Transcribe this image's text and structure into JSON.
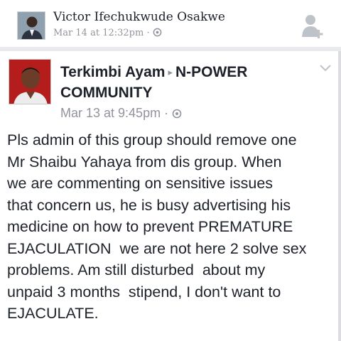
{
  "top_post": {
    "author": "Victor Ifechukwude Osakwe",
    "timestamp": "Mar 14 at 12:32pm",
    "separator": "·",
    "privacy_icon": "globe-icon",
    "action_icon": "add-friend-icon"
  },
  "post": {
    "author": "Terkimbi Ayam",
    "group": "N-POWER COMMUNITY",
    "arrow": "▸",
    "timestamp": "Mar 13 at 9:45pm",
    "separator": "·",
    "privacy_icon": "globe-icon",
    "menu_icon": "chevron-down-icon",
    "body_lines": [
      "Pls admin of this group should remove one",
      "Mr Shaibu Yahaya from dis group. When",
      "we are commenting on sensitive issues",
      "that concern us, he is busy advertising his",
      "medicine on how to prevent PREMATURE",
      "EJACULATION  we are not here 2 solve sex",
      "problems. Am still disturbed  about my",
      "unpaid 3 months  stipend, I don't want to",
      "EJACULATE."
    ]
  },
  "colors": {
    "background": "#e9eaee",
    "text": "#1d2129",
    "meta": "#90949c",
    "avatar_red": "#b51d1d"
  }
}
